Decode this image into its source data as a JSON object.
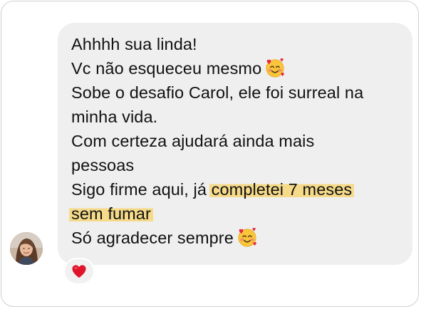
{
  "message": {
    "lines": [
      "Ahhhh sua linda!",
      "Vc não esqueceu mesmo",
      "Sobe o desafio Carol, ele foi surreal na",
      "minha vida.",
      "Com certeza ajudará ainda mais",
      "pessoas",
      "Sigo firme aqui, já ",
      "completei 7 meses",
      "sem fumar",
      "Só agradecer sempre"
    ],
    "emoji": "smiling-face-with-hearts-icon",
    "highlight_color": "#f7d778",
    "bubble_color": "#efefef"
  },
  "reaction": {
    "icon": "red-heart-icon",
    "color": "#e0142a"
  },
  "avatar": {
    "icon": "user-avatar"
  }
}
